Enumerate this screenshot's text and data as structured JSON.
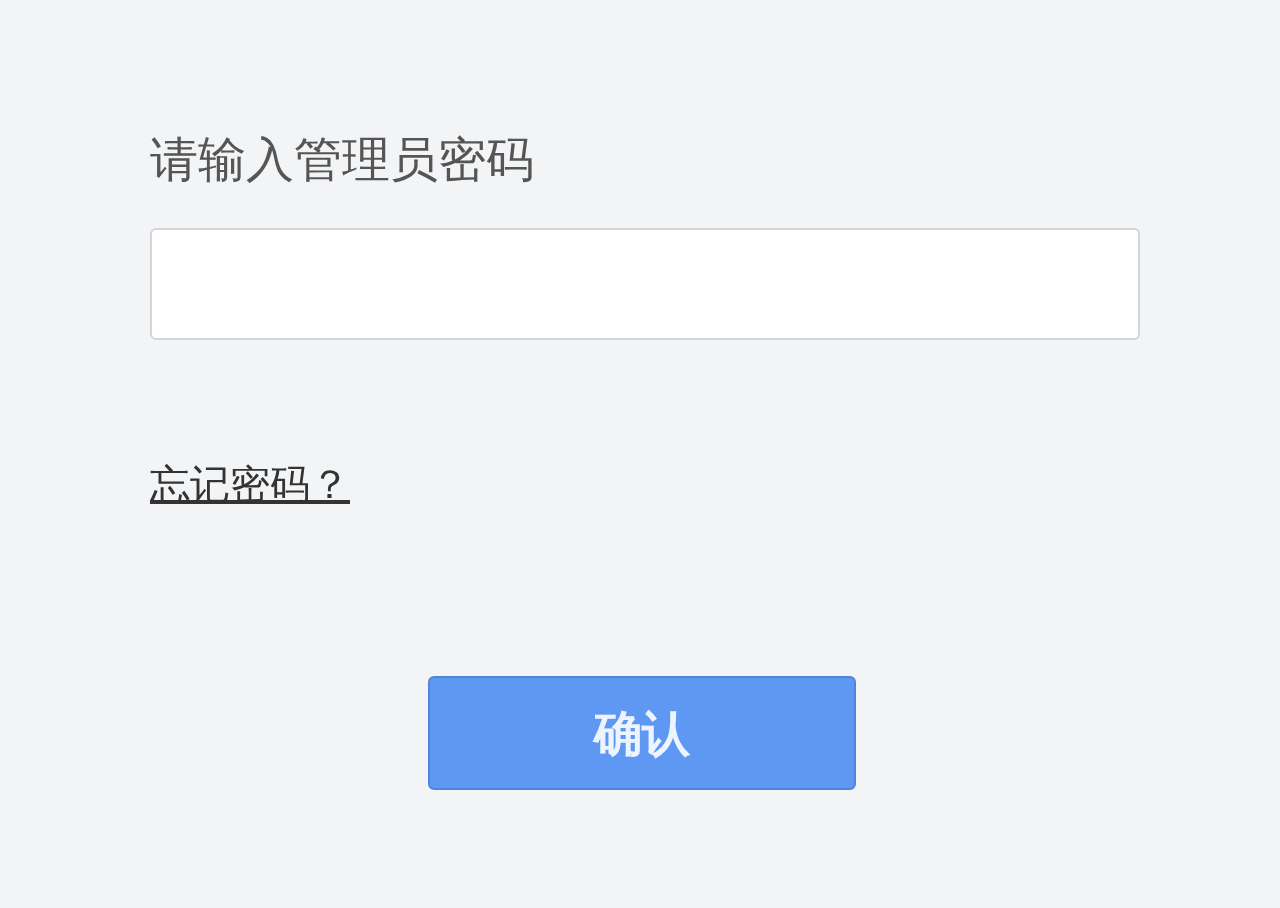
{
  "title": "请输入管理员密码",
  "forgot_link": "忘记密码？",
  "confirm_button": "确认"
}
